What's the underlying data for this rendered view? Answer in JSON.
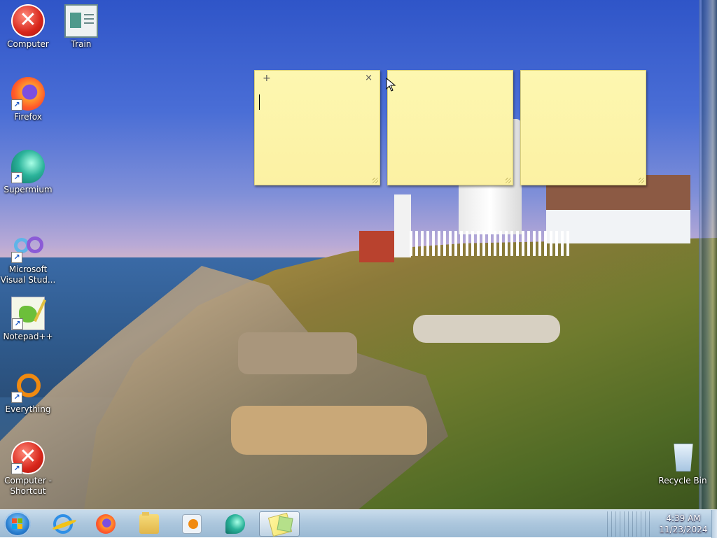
{
  "desktop": {
    "icons": [
      {
        "label": "Computer",
        "icon": "error-icon",
        "shortcut": false
      },
      {
        "label": "Train",
        "icon": "document-icon",
        "shortcut": false
      },
      {
        "label": "Firefox",
        "icon": "firefox-icon",
        "shortcut": true
      },
      {
        "label": "Supermium",
        "icon": "supermium-icon",
        "shortcut": true
      },
      {
        "label": "Microsoft Visual Stud...",
        "icon": "visual-studio-icon",
        "shortcut": true
      },
      {
        "label": "Notepad++",
        "icon": "notepadpp-icon",
        "shortcut": true
      },
      {
        "label": "Everything",
        "icon": "everything-icon",
        "shortcut": true
      },
      {
        "label": "Computer - Shortcut",
        "icon": "error-icon",
        "shortcut": true
      },
      {
        "label": "Recycle Bin",
        "icon": "recycle-bin-icon",
        "shortcut": false
      }
    ]
  },
  "sticky_notes": {
    "add_symbol": "+",
    "close_symbol": "×",
    "notes": [
      {
        "text": ""
      },
      {
        "text": ""
      },
      {
        "text": ""
      }
    ]
  },
  "taskbar": {
    "items": [
      {
        "name": "start-button",
        "icon": "windows-orb-icon"
      },
      {
        "name": "internet-explorer",
        "icon": "ie-icon"
      },
      {
        "name": "firefox",
        "icon": "firefox-icon"
      },
      {
        "name": "file-explorer",
        "icon": "folder-icon"
      },
      {
        "name": "media-player",
        "icon": "media-player-icon"
      },
      {
        "name": "supermium",
        "icon": "supermium-icon"
      },
      {
        "name": "sticky-notes",
        "icon": "sticky-notes-icon",
        "active": true
      }
    ],
    "clock": {
      "time": "4:39 AM",
      "date": "11/23/2024"
    }
  },
  "colors": {
    "note_yellow": "#fcf1a3",
    "taskbar": "#aec8de",
    "error_red": "#d8261b"
  }
}
